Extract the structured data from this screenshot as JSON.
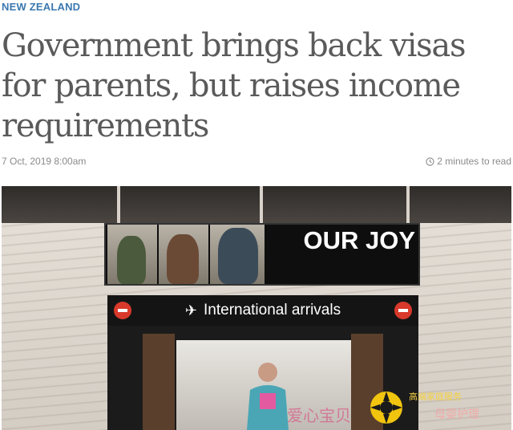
{
  "article": {
    "section": "NEW ZEALAND",
    "headline": "Government brings back visas for parents, but raises income requirements",
    "date": "7 Oct, 2019 8:00am",
    "read_time": "2 minutes to read"
  },
  "photo": {
    "screen_text": "OUR JOY",
    "gate_sign": "International arrivals",
    "icons": [
      "plane-icon",
      "no-entry-icon",
      "clock-icon"
    ],
    "watermark": {
      "text": "爱心宝贝",
      "logo_caption": "高端家庭服务",
      "subtitle": "母婴护理"
    }
  },
  "colors": {
    "section_tag": "#3a78b0",
    "headline": "#5a5a5a",
    "meta": "#8a8a8a"
  }
}
